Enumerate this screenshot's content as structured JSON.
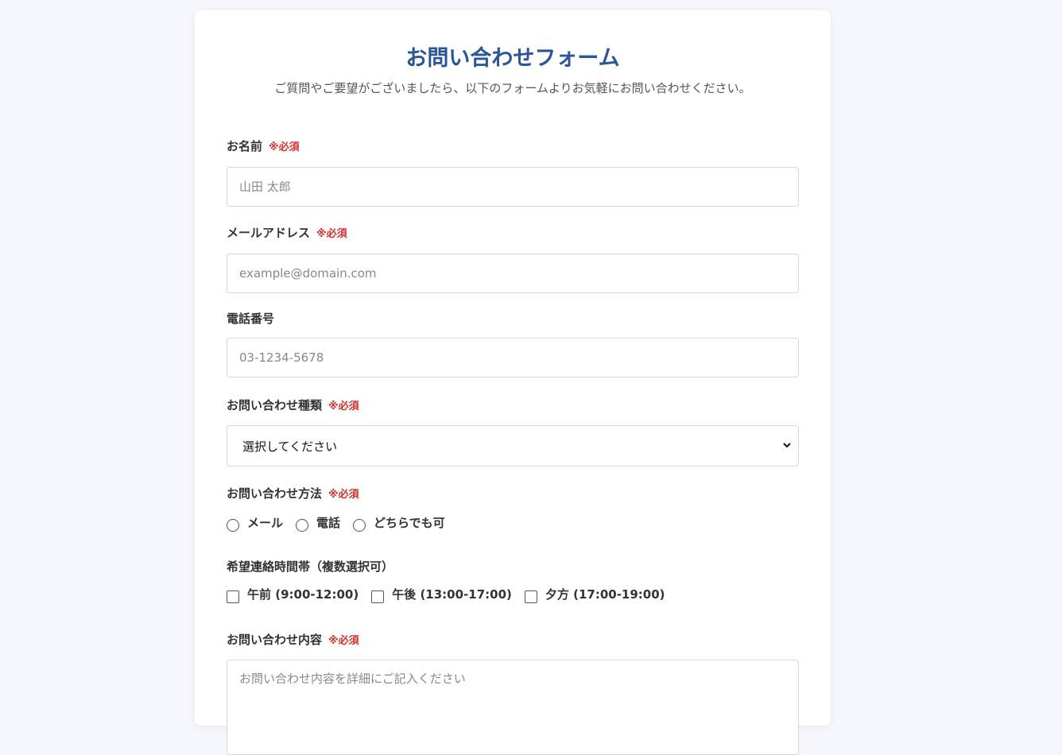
{
  "form": {
    "title": "お問い合わせフォーム",
    "subtitle": "ご質問やご要望がございましたら、以下のフォームよりお気軽にお問い合わせください。",
    "required_mark": "※必須",
    "name": {
      "label": "お名前",
      "placeholder": "山田 太郎"
    },
    "email": {
      "label": "メールアドレス",
      "placeholder": "example@domain.com"
    },
    "phone": {
      "label": "電話番号",
      "placeholder": "03-1234-5678"
    },
    "inquiry_type": {
      "label": "お問い合わせ種類",
      "selected": "選択してください"
    },
    "contact_method": {
      "label": "お問い合わせ方法",
      "options": [
        "メール",
        "電話",
        "どちらでも可"
      ]
    },
    "contact_time": {
      "label": "希望連絡時間帯（複数選択可）",
      "options": [
        "午前 (9:00-12:00)",
        "午後 (13:00-17:00)",
        "夕方 (17:00-19:00)"
      ]
    },
    "message": {
      "label": "お問い合わせ内容",
      "placeholder": "お問い合わせ内容を詳細にご記入ください"
    }
  },
  "colors": {
    "title": "#2a5597",
    "required": "#d0312d",
    "background": "#f4f7fb"
  }
}
